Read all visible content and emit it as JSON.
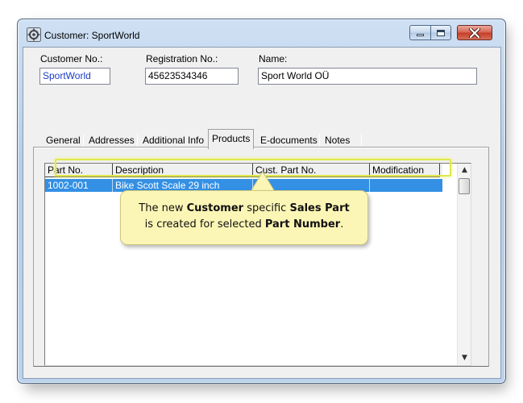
{
  "window": {
    "title": "Customer: SportWorld",
    "buttons": {
      "minimize": "minimize",
      "maximize": "maximize",
      "close": "close"
    }
  },
  "header_fields": {
    "customer_no": {
      "label": "Customer No.:",
      "value": "SportWorld"
    },
    "registration_no": {
      "label": "Registration No.:",
      "value": "45623534346"
    },
    "name": {
      "label": "Name:",
      "value": "Sport World OÜ"
    }
  },
  "tabs": [
    {
      "label": "General"
    },
    {
      "label": "Addresses"
    },
    {
      "label": "Additional Info"
    },
    {
      "label": "Products",
      "active": true
    },
    {
      "label": "E-documents"
    },
    {
      "label": "Notes"
    }
  ],
  "products_table": {
    "columns": [
      "Part No.",
      "Description",
      "Cust. Part No.",
      "Modification"
    ],
    "rows": [
      {
        "part_no": "1002-001",
        "description": "Bike Scott Scale 29 inch",
        "cust_part_no": "",
        "modification": "",
        "selected": true
      }
    ]
  },
  "callout": {
    "t1": "The new ",
    "b1": "Customer",
    "t2": " specific ",
    "b2": "Sales Part",
    "t3": "is created for selected ",
    "b3": "Part Number",
    "t4": "."
  },
  "colors": {
    "selection": "#3390e5",
    "highlight": "#dfe84c",
    "callout_bg": "#fcf6b6",
    "link_text": "#1a3cc8"
  }
}
